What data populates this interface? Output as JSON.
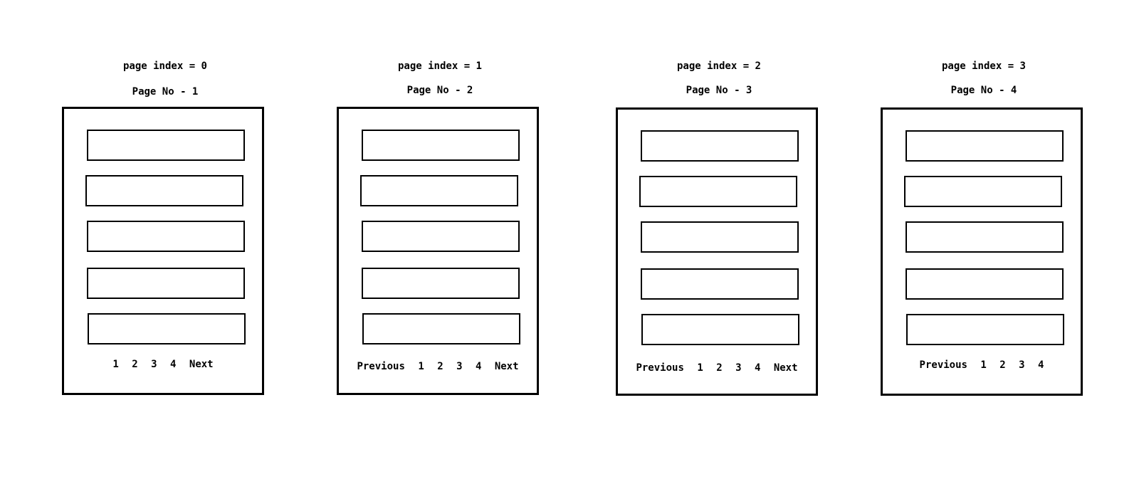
{
  "panels": [
    {
      "index_label": "page index = 0",
      "page_label": "Page No - 1",
      "pager": {
        "previous": "",
        "pages": [
          "1",
          "2",
          "3",
          "4"
        ],
        "next": "Next"
      }
    },
    {
      "index_label": "page index = 1",
      "page_label": "Page No - 2",
      "pager": {
        "previous": "Previous",
        "pages": [
          "1",
          "2",
          "3",
          "4"
        ],
        "next": "Next"
      }
    },
    {
      "index_label": "page index = 2",
      "page_label": "Page No - 3",
      "pager": {
        "previous": "Previous",
        "pages": [
          "1",
          "2",
          "3",
          "4"
        ],
        "next": "Next"
      }
    },
    {
      "index_label": "page index = 3",
      "page_label": "Page No - 4",
      "pager": {
        "previous": "Previous",
        "pages": [
          "1",
          "2",
          "3",
          "4"
        ],
        "next": ""
      }
    }
  ]
}
